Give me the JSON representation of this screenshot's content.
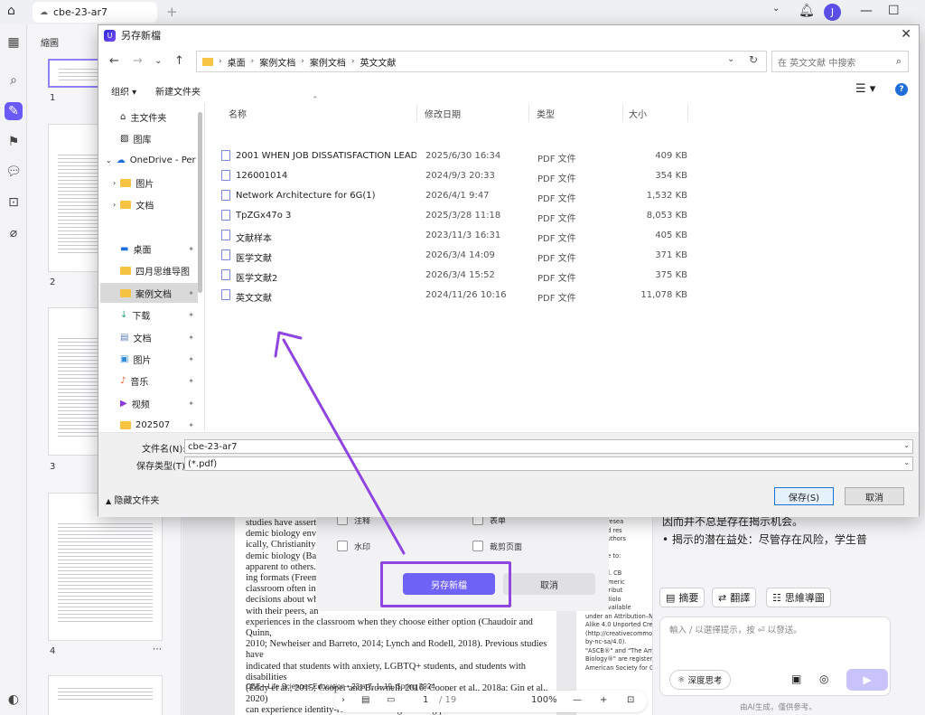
{
  "app": {
    "tab_title": "cbe-23-ar7",
    "user_initial": "J",
    "accent": "#6f62f7",
    "thumbs_header": "縮圖",
    "page_numbers": [
      "1",
      "2",
      "3",
      "4"
    ]
  },
  "document": {
    "paragraph": "studies have asserte\ndemic biology envir\nically, Christianity c\ndemic biology (Bar\napparent to others.\ning formats (Freem\nclassroom often incl\ndecisions about whe\nwith their peers, an\nexperiences in the classroom when they choose either option (Chaudoir and Quinn,\n2010; Newheiser and Barreto, 2014; Lynch and Rodell, 2018). Previous studies have\nindicated that students with anxiety, LGBTQ+ students, and students with disabilities\n(Eddy et al., 2015; Cooper and Brownell, 2016; Cooper et al., 2018a; Gin et al., 2020)\ncan experience identity-relevant challenges during peer interactions that force them to\neither reveal or conceal their identities, but little is known about the experiences of",
    "footer": "CBE—Life Sciences Education • 23:ar7, 1–19, Spring 2024",
    "side_column": "signed resea\nerpreted res\nrt. All authors\npt.\nondence to:\nul\nrds et al. CB\n3 The Americ\ne is distribut\nor Cell Biolo\n). It is available\nunder an Attribution–Noncom\nAlike 4.0 Unported Creative Co\n(http://creativecommons.org/\nby-nc-sa/4.0).\n\"ASCB®\" and \"The American So\nBiology®\" are registered trade\nAmerican Society for Cell Biolo"
  },
  "export_panel": {
    "options": [
      {
        "label": "注释"
      },
      {
        "label": "表单"
      },
      {
        "label": "水印"
      },
      {
        "label": "裁剪页面"
      }
    ],
    "save_as_label": "另存新檔",
    "cancel_label": "取消"
  },
  "pagenav": {
    "current_page": "1",
    "total_pages": "/ 19",
    "zoom": "100%"
  },
  "ai_panel": {
    "summary_text": "因而并不总是存在揭示机会。\n• 揭示的潜在益处：尽管存在风险，学生普",
    "chips": [
      {
        "label": "摘要"
      },
      {
        "label": "翻譯"
      },
      {
        "label": "思維導圖"
      }
    ],
    "input_placeholder": "輸入 / 以選擇提示，按 ⏎ 以發送。",
    "deep_think_label": "深度思考",
    "footer_note": "由AI生成，僅供參考。"
  },
  "dialog": {
    "title": "另存新檔",
    "breadcrumb": [
      "桌面",
      "案例文档",
      "案例文档",
      "英文文献"
    ],
    "search_placeholder": "在 英文文献 中搜索",
    "organize_label": "组织 ▾",
    "new_folder_label": "新建文件夹",
    "nav_items": [
      {
        "label": "主文件夹",
        "icon": "home-icon"
      },
      {
        "label": "图库",
        "icon": "gallery-icon"
      },
      {
        "label": "OneDrive - Per",
        "icon": "cloud-icon"
      },
      {
        "label": "图片",
        "icon": "folder-icon"
      },
      {
        "label": "文档",
        "icon": "folder-icon"
      },
      {
        "label": "桌面",
        "icon": "desktop-icon"
      },
      {
        "label": "四月思维导图",
        "icon": "folder-icon"
      },
      {
        "label": "案例文档",
        "icon": "folder-icon"
      },
      {
        "label": "下载",
        "icon": "download-icon"
      },
      {
        "label": "文档",
        "icon": "documents-icon"
      },
      {
        "label": "图片",
        "icon": "pictures-icon"
      },
      {
        "label": "音乐",
        "icon": "music-icon"
      },
      {
        "label": "视频",
        "icon": "video-icon"
      },
      {
        "label": "202507",
        "icon": "folder-icon"
      }
    ],
    "columns": [
      "名称",
      "修改日期",
      "类型",
      "大小"
    ],
    "files": [
      {
        "name": "2001 WHEN JOB DISSATISFACTION LEADS ...",
        "date": "2025/6/30 16:34",
        "type": "PDF 文件",
        "size": "409 KB"
      },
      {
        "name": "126001014",
        "date": "2024/9/3 20:33",
        "type": "PDF 文件",
        "size": "354 KB"
      },
      {
        "name": "Network Architecture for 6G(1)",
        "date": "2026/4/1 9:47",
        "type": "PDF 文件",
        "size": "1,532 KB"
      },
      {
        "name": "TpZGx47o 3",
        "date": "2025/3/28 11:18",
        "type": "PDF 文件",
        "size": "8,053 KB"
      },
      {
        "name": "文献样本",
        "date": "2023/11/3 16:31",
        "type": "PDF 文件",
        "size": "405 KB"
      },
      {
        "name": "医学文献",
        "date": "2026/3/4 14:09",
        "type": "PDF 文件",
        "size": "371 KB"
      },
      {
        "name": "医学文献2",
        "date": "2026/3/4 15:52",
        "type": "PDF 文件",
        "size": "375 KB"
      },
      {
        "name": "英文文献",
        "date": "2024/11/26 10:16",
        "type": "PDF 文件",
        "size": "11,078 KB"
      }
    ],
    "filename_label": "文件名(N):",
    "filename_value": "cbe-23-ar7",
    "filetype_label": "保存类型(T):",
    "filetype_value": "(*.pdf)",
    "hide_folders_label": "隐藏文件夹",
    "save_label": "保存(S)",
    "cancel_label": "取消"
  },
  "annotation": {
    "arrow_color": "#8f46e0"
  }
}
